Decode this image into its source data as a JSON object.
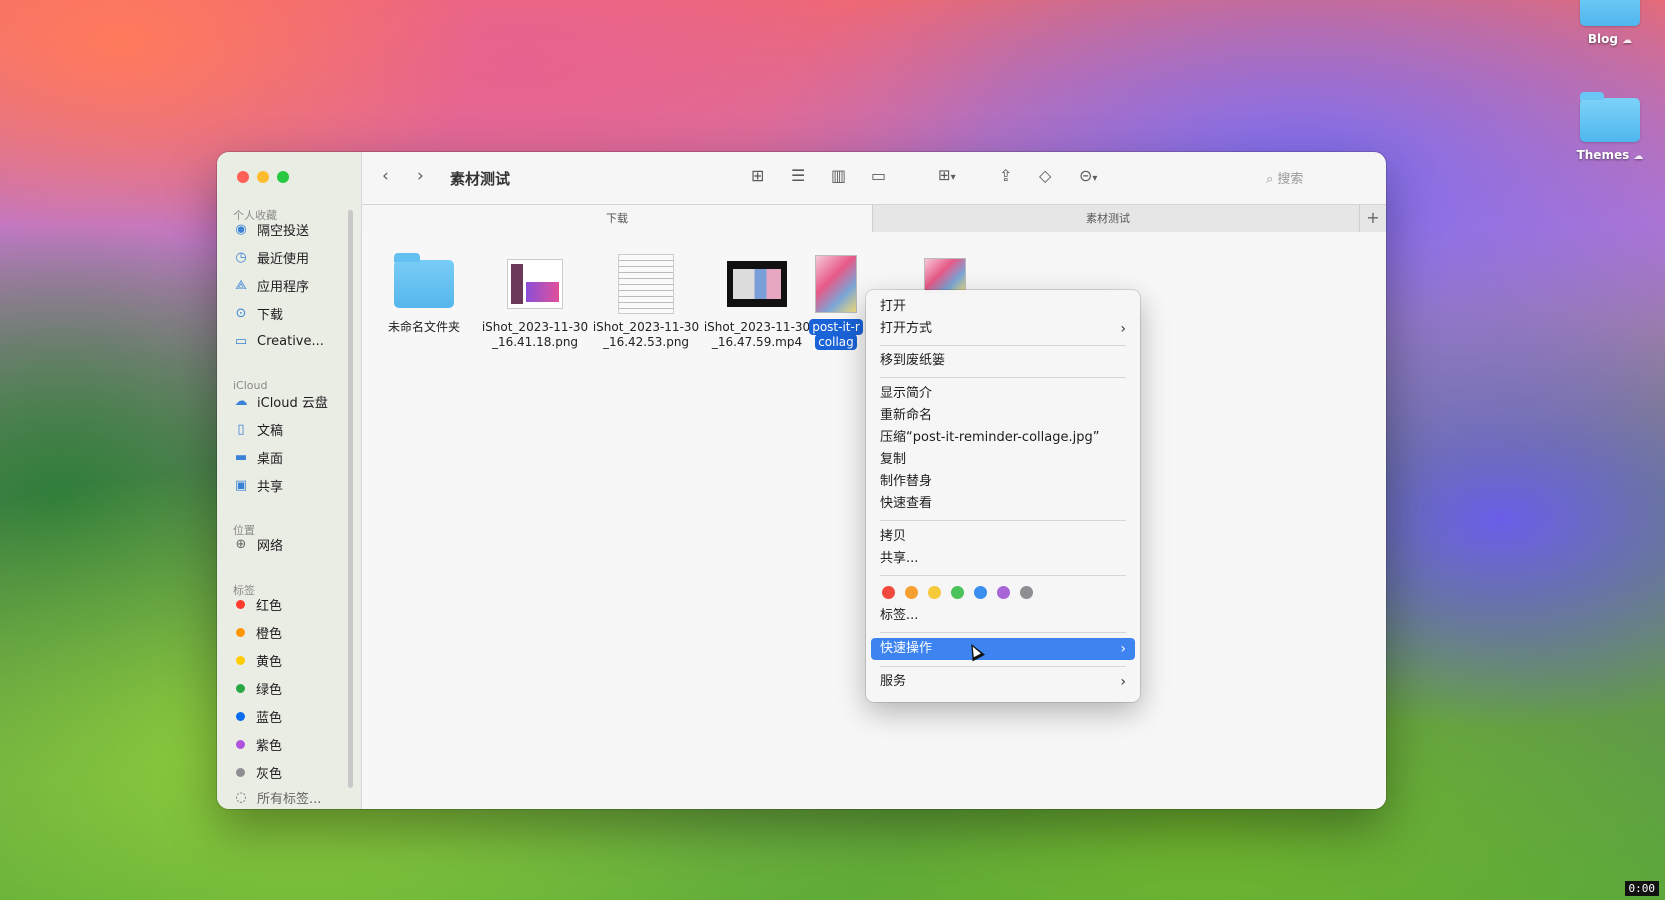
{
  "desktop": {
    "icons": [
      {
        "label": "Blog"
      },
      {
        "label": "Themes"
      }
    ],
    "clock": "0:00"
  },
  "window": {
    "title": "素材测试",
    "search_placeholder": "搜索",
    "tabs": [
      {
        "label": "下载"
      },
      {
        "label": "素材测试"
      }
    ],
    "add_tab": "+"
  },
  "sidebar": {
    "favorites_header": "个人收藏",
    "favorites": [
      {
        "label": "隔空投送",
        "icon": "airdrop-icon"
      },
      {
        "label": "最近使用",
        "icon": "clock-icon"
      },
      {
        "label": "应用程序",
        "icon": "apps-icon"
      },
      {
        "label": "下载",
        "icon": "download-icon"
      },
      {
        "label": "Creative...",
        "icon": "folder-icon"
      }
    ],
    "icloud_header": "iCloud",
    "icloud": [
      {
        "label": "iCloud 云盘",
        "icon": "cloud-icon"
      },
      {
        "label": "文稿",
        "icon": "document-icon"
      },
      {
        "label": "桌面",
        "icon": "desktop-icon"
      },
      {
        "label": "共享",
        "icon": "shared-folder-icon"
      }
    ],
    "locations_header": "位置",
    "locations": [
      {
        "label": "网络",
        "icon": "network-icon"
      }
    ],
    "tags_header": "标签",
    "tags": [
      {
        "label": "红色",
        "color": "#ff3b30"
      },
      {
        "label": "橙色",
        "color": "#ff9500"
      },
      {
        "label": "黄色",
        "color": "#ffcc00"
      },
      {
        "label": "绿色",
        "color": "#28a745"
      },
      {
        "label": "蓝色",
        "color": "#0a6cf0"
      },
      {
        "label": "紫色",
        "color": "#af52de"
      },
      {
        "label": "灰色",
        "color": "#8e8e93"
      }
    ],
    "all_tags": "所有标签..."
  },
  "files": [
    {
      "name_line1": "未命名文件夹",
      "name_line2": "",
      "kind": "folder"
    },
    {
      "name_line1": "iShot_2023-11-30",
      "name_line2": "_16.41.18.png",
      "kind": "image"
    },
    {
      "name_line1": "iShot_2023-11-30",
      "name_line2": "_16.42.53.png",
      "kind": "doc"
    },
    {
      "name_line1": "iShot_2023-11-30",
      "name_line2": "_16.47.59.mp4",
      "kind": "video"
    },
    {
      "name_line1": "post-it-r",
      "name_line2": "collag",
      "kind": "photo",
      "selected": true
    },
    {
      "name_line1": "",
      "name_line2": "",
      "kind": "photo"
    }
  ],
  "context_menu": {
    "open": "打开",
    "open_with": "打开方式",
    "move_to_trash": "移到废纸篓",
    "get_info": "显示简介",
    "rename": "重新命名",
    "compress": "压缩“post-it-reminder-collage.jpg”",
    "duplicate": "复制",
    "make_alias": "制作替身",
    "quick_look": "快速查看",
    "copy": "拷贝",
    "share": "共享...",
    "tag_colors": [
      "#f04a3e",
      "#f5a030",
      "#f5c93a",
      "#4cc25a",
      "#3a8ef0",
      "#a865d8",
      "#8e8e93"
    ],
    "tags": "标签...",
    "quick_actions": "快速操作",
    "services": "服务"
  }
}
